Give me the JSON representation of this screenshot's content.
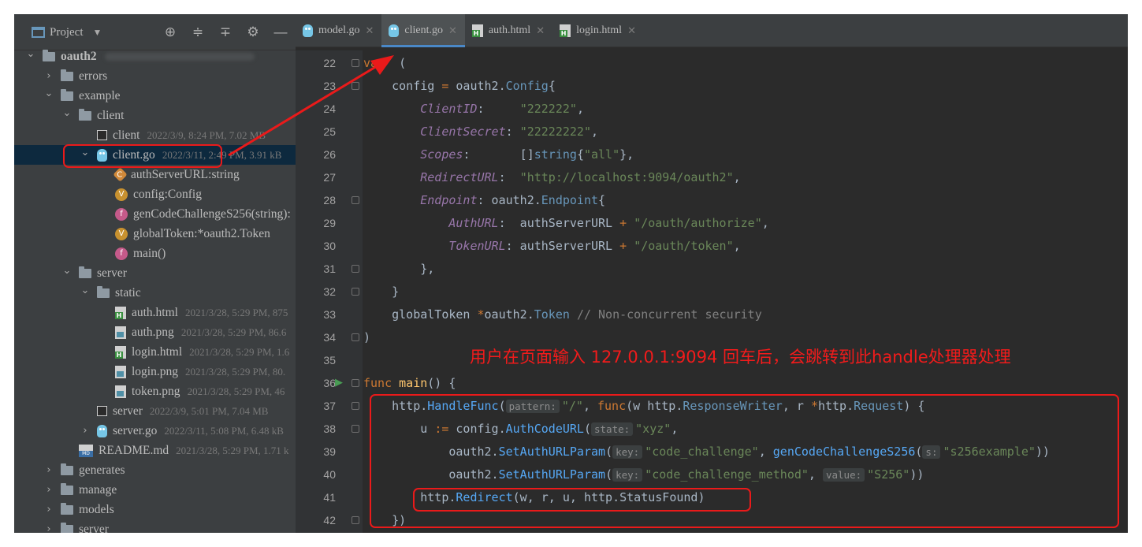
{
  "project_panel": {
    "title": "Project",
    "tools": [
      "target-icon",
      "expand-all-icon",
      "collapse-all-icon",
      "gear-icon",
      "minimize-icon"
    ],
    "tree": [
      {
        "depth": 0,
        "expand": "open",
        "icon": "folder",
        "label": "oauth2",
        "meta": "",
        "blurred": true
      },
      {
        "depth": 1,
        "expand": "closed",
        "icon": "folder",
        "label": "errors",
        "meta": ""
      },
      {
        "depth": 1,
        "expand": "open",
        "icon": "folder",
        "label": "example",
        "meta": ""
      },
      {
        "depth": 2,
        "expand": "open",
        "icon": "folder",
        "label": "client",
        "meta": ""
      },
      {
        "depth": 3,
        "expand": "none",
        "icon": "binary",
        "label": "client",
        "meta": "2022/3/9, 8:24 PM, 7.02 MB"
      },
      {
        "depth": 3,
        "expand": "open",
        "icon": "go",
        "label": "client.go",
        "meta": "2022/3/11, 2:49 PM, 3.91 kB",
        "selected": true
      },
      {
        "depth": 4,
        "expand": "none",
        "icon": "const",
        "label": "authServerURL:string",
        "meta": ""
      },
      {
        "depth": 4,
        "expand": "none",
        "icon": "var",
        "label": "config:Config",
        "meta": ""
      },
      {
        "depth": 4,
        "expand": "none",
        "icon": "func",
        "label": "genCodeChallengeS256(string):",
        "meta": ""
      },
      {
        "depth": 4,
        "expand": "none",
        "icon": "var",
        "label": "globalToken:*oauth2.Token",
        "meta": ""
      },
      {
        "depth": 4,
        "expand": "none",
        "icon": "func",
        "label": "main()",
        "meta": ""
      },
      {
        "depth": 2,
        "expand": "open",
        "icon": "folder",
        "label": "server",
        "meta": ""
      },
      {
        "depth": 3,
        "expand": "open",
        "icon": "folder",
        "label": "static",
        "meta": ""
      },
      {
        "depth": 4,
        "expand": "none",
        "icon": "html",
        "label": "auth.html",
        "meta": "2021/3/28, 5:29 PM, 875"
      },
      {
        "depth": 4,
        "expand": "none",
        "icon": "png",
        "label": "auth.png",
        "meta": "2021/3/28, 5:29 PM, 86.6"
      },
      {
        "depth": 4,
        "expand": "none",
        "icon": "html",
        "label": "login.html",
        "meta": "2021/3/28, 5:29 PM, 1.6"
      },
      {
        "depth": 4,
        "expand": "none",
        "icon": "png",
        "label": "login.png",
        "meta": "2021/3/28, 5:29 PM, 80."
      },
      {
        "depth": 4,
        "expand": "none",
        "icon": "png",
        "label": "token.png",
        "meta": "2021/3/28, 5:29 PM, 46"
      },
      {
        "depth": 3,
        "expand": "none",
        "icon": "binary",
        "label": "server",
        "meta": "2022/3/9, 5:01 PM, 7.04 MB"
      },
      {
        "depth": 3,
        "expand": "closed",
        "icon": "go",
        "label": "server.go",
        "meta": "2022/3/11, 5:08 PM, 6.48 kB"
      },
      {
        "depth": 2,
        "expand": "none",
        "icon": "md",
        "label": "README.md",
        "meta": "2021/3/28, 5:29 PM, 1.71 k"
      },
      {
        "depth": 1,
        "expand": "closed",
        "icon": "folder",
        "label": "generates",
        "meta": ""
      },
      {
        "depth": 1,
        "expand": "closed",
        "icon": "folder",
        "label": "manage",
        "meta": ""
      },
      {
        "depth": 1,
        "expand": "closed",
        "icon": "folder",
        "label": "models",
        "meta": ""
      },
      {
        "depth": 1,
        "expand": "closed",
        "icon": "folder",
        "label": "server",
        "meta": ""
      }
    ]
  },
  "tabs": [
    {
      "icon": "go",
      "label": "model.go",
      "active": false
    },
    {
      "icon": "go",
      "label": "client.go",
      "active": true
    },
    {
      "icon": "html",
      "label": "auth.html",
      "active": false
    },
    {
      "icon": "html",
      "label": "login.html",
      "active": false
    }
  ],
  "code_lines": [
    {
      "n": "22",
      "fold": true,
      "tokens": [
        [
          "kw",
          "var"
        ],
        [
          "",
          "  ("
        ]
      ]
    },
    {
      "n": "23",
      "fold": true,
      "tokens": [
        [
          "",
          "    config "
        ],
        [
          "op",
          "="
        ],
        [
          "",
          " oauth2."
        ],
        [
          "ty",
          "Config"
        ],
        [
          "",
          "{"
        ]
      ]
    },
    {
      "n": "24",
      "tokens": [
        [
          "",
          "        "
        ],
        [
          "it",
          "ClientID"
        ],
        [
          "",
          ":     "
        ],
        [
          "str",
          "\"222222\""
        ],
        [
          "",
          ","
        ]
      ]
    },
    {
      "n": "25",
      "tokens": [
        [
          "",
          "        "
        ],
        [
          "it",
          "ClientSecret"
        ],
        [
          "",
          ": "
        ],
        [
          "str",
          "\"22222222\""
        ],
        [
          "",
          ","
        ]
      ]
    },
    {
      "n": "26",
      "tokens": [
        [
          "",
          "        "
        ],
        [
          "it",
          "Scopes"
        ],
        [
          "",
          ":       []"
        ],
        [
          "ty",
          "string"
        ],
        [
          "",
          "{"
        ],
        [
          "str",
          "\"all\""
        ],
        [
          "",
          "},"
        ]
      ]
    },
    {
      "n": "27",
      "tokens": [
        [
          "",
          "        "
        ],
        [
          "it",
          "RedirectURL"
        ],
        [
          "",
          ":  "
        ],
        [
          "str",
          "\"http://localhost:9094/oauth2\""
        ],
        [
          "",
          ","
        ]
      ]
    },
    {
      "n": "28",
      "fold": true,
      "tokens": [
        [
          "",
          "        "
        ],
        [
          "it",
          "Endpoint"
        ],
        [
          "",
          ": oauth2."
        ],
        [
          "ty",
          "Endpoint"
        ],
        [
          "",
          "{"
        ]
      ]
    },
    {
      "n": "29",
      "tokens": [
        [
          "",
          "            "
        ],
        [
          "it",
          "AuthURL"
        ],
        [
          "",
          ":  authServerURL "
        ],
        [
          "op",
          "+"
        ],
        [
          "",
          " "
        ],
        [
          "str",
          "\"/oauth/authorize\""
        ],
        [
          "",
          ","
        ]
      ]
    },
    {
      "n": "30",
      "tokens": [
        [
          "",
          "            "
        ],
        [
          "it",
          "TokenURL"
        ],
        [
          "",
          ": authServerURL "
        ],
        [
          "op",
          "+"
        ],
        [
          "",
          " "
        ],
        [
          "str",
          "\"/oauth/token\""
        ],
        [
          "",
          ","
        ]
      ]
    },
    {
      "n": "31",
      "fold": true,
      "tokens": [
        [
          "",
          "        },"
        ]
      ]
    },
    {
      "n": "32",
      "fold": true,
      "tokens": [
        [
          "",
          "    }"
        ]
      ]
    },
    {
      "n": "33",
      "tokens": [
        [
          "",
          "    globalToken "
        ],
        [
          "op",
          "*"
        ],
        [
          "",
          "oauth2."
        ],
        [
          "ty",
          "Token"
        ],
        [
          "",
          " "
        ],
        [
          "cm",
          "// Non-concurrent security"
        ]
      ]
    },
    {
      "n": "34",
      "fold": true,
      "tokens": [
        [
          "",
          ")"
        ]
      ]
    },
    {
      "n": "35",
      "tokens": []
    },
    {
      "n": "36",
      "run": true,
      "fold": true,
      "tokens": [
        [
          "kw",
          "func"
        ],
        [
          "",
          " "
        ],
        [
          "fn",
          "main"
        ],
        [
          "",
          "() {"
        ]
      ]
    },
    {
      "n": "37",
      "fold": true,
      "tokens": [
        [
          "",
          "    http."
        ],
        [
          "mcall",
          "HandleFunc"
        ],
        [
          "",
          "("
        ],
        [
          "hint",
          "pattern:"
        ],
        [
          "str",
          "\"/\""
        ],
        [
          "",
          ", "
        ],
        [
          "kw",
          "func"
        ],
        [
          "",
          "(w http."
        ],
        [
          "ty",
          "ResponseWriter"
        ],
        [
          "",
          ", r "
        ],
        [
          "op",
          "*"
        ],
        [
          "",
          "http."
        ],
        [
          "ty",
          "Request"
        ],
        [
          "",
          ") {"
        ]
      ]
    },
    {
      "n": "38",
      "fold": true,
      "tokens": [
        [
          "",
          "        u "
        ],
        [
          "op",
          ":="
        ],
        [
          "",
          " config."
        ],
        [
          "mcall",
          "AuthCodeURL"
        ],
        [
          "",
          "("
        ],
        [
          "hint",
          "state:"
        ],
        [
          "str",
          "\"xyz\""
        ],
        [
          "",
          ","
        ]
      ]
    },
    {
      "n": "39",
      "tokens": [
        [
          "",
          "            oauth2."
        ],
        [
          "mcall",
          "SetAuthURLParam"
        ],
        [
          "",
          "("
        ],
        [
          "hint",
          "key:"
        ],
        [
          "str",
          "\"code_challenge\""
        ],
        [
          "",
          ", "
        ],
        [
          "mcall",
          "genCodeChallengeS256"
        ],
        [
          "",
          "("
        ],
        [
          "hint",
          "s:"
        ],
        [
          "str",
          "\"s256example\""
        ],
        [
          "",
          "))"
        ]
      ]
    },
    {
      "n": "40",
      "tokens": [
        [
          "",
          "            oauth2."
        ],
        [
          "mcall",
          "SetAuthURLParam"
        ],
        [
          "",
          "("
        ],
        [
          "hint",
          "key:"
        ],
        [
          "str",
          "\"code_challenge_method\""
        ],
        [
          "",
          ", "
        ],
        [
          "hint",
          "value:"
        ],
        [
          "str",
          "\"S256\""
        ],
        [
          "",
          "))"
        ]
      ]
    },
    {
      "n": "41",
      "tokens": [
        [
          "",
          "        http."
        ],
        [
          "mcall",
          "Redirect"
        ],
        [
          "",
          "(w, r, u, http.StatusFound)"
        ]
      ]
    },
    {
      "n": "42",
      "fold": true,
      "tokens": [
        [
          "",
          "    })"
        ]
      ]
    }
  ],
  "annotation": {
    "note": "用户在页面输入 127.0.0.1:9094 回车后，会跳转到此handle处理器处理",
    "color": "#ea1a1a"
  }
}
